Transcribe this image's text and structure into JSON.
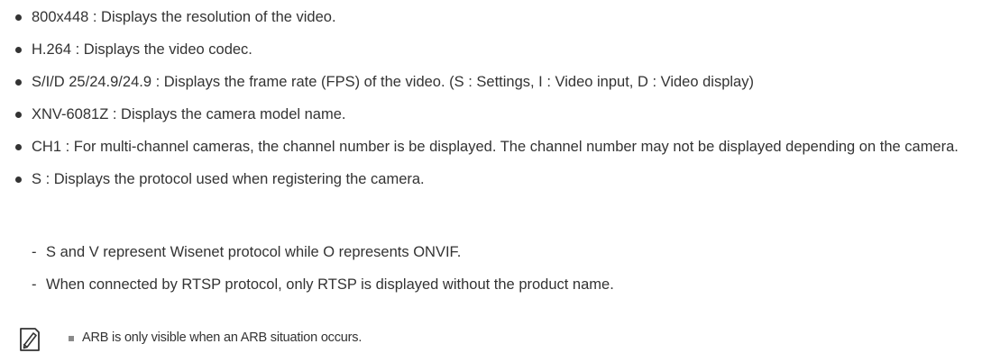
{
  "items": [
    "800x448 : Displays the resolution of the video.",
    "H.264 : Displays the video codec.",
    "S/I/D 25/24.9/24.9 : Displays the frame rate (FPS) of the video. (S : Settings, I : Video input, D : Video display)",
    "XNV-6081Z : Displays the camera model name.",
    "CH1 : For multi-channel cameras, the channel number is be displayed. The channel number may not be displayed depending on the camera.",
    "S : Displays the protocol used when registering the camera."
  ],
  "sub_items": [
    "S and V represent Wisenet protocol while O represents ONVIF.",
    "When connected by RTSP protocol, only RTSP is displayed without the product name."
  ],
  "sub_marker": "-",
  "note": {
    "icon": "pencil-note-icon",
    "text": "ARB is only visible when an ARB situation occurs."
  }
}
